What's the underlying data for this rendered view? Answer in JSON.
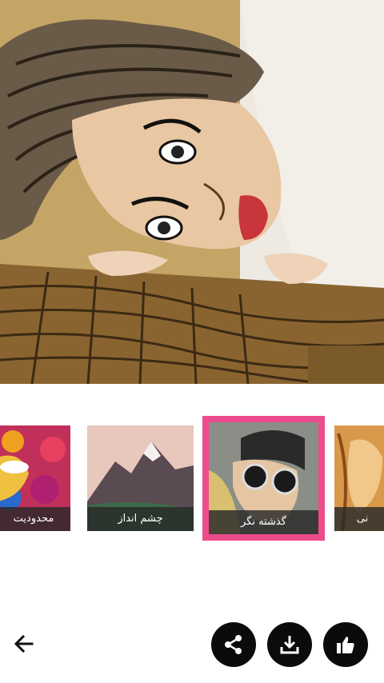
{
  "artwork": {
    "description_icon": "stylized-portrait-image"
  },
  "filters": [
    {
      "label": "محدودیت",
      "thumb_icon": "colorful-flowers-portrait"
    },
    {
      "label": "چشم انداز",
      "thumb_icon": "mountain-landscape"
    },
    {
      "label": "گذشته نگر",
      "thumb_icon": "sunglasses-portrait",
      "selected": true
    },
    {
      "label": "نی",
      "thumb_icon": "blonde-hair-portrait"
    }
  ],
  "toolbar": {
    "back_icon": "arrow-left-icon",
    "share_icon": "share-icon",
    "download_icon": "download-icon",
    "like_icon": "thumbs-up-icon"
  },
  "colors": {
    "selected_border": "#ec4c8c",
    "button_bg": "#0b0b0b"
  }
}
